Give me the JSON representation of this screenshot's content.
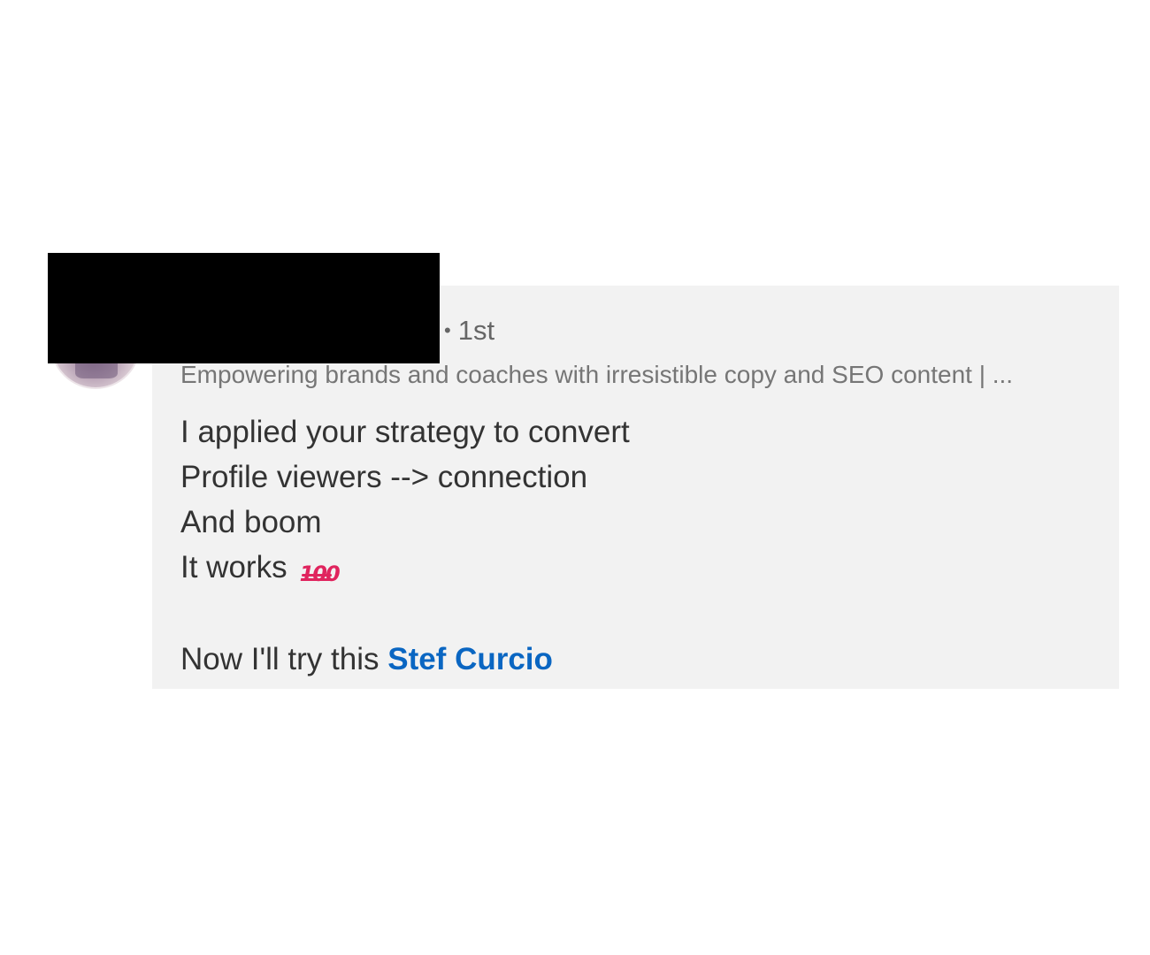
{
  "comment": {
    "author_degree": "1st",
    "author_headline": "Empowering brands and coaches with irresistible copy and SEO content | ...",
    "lines": [
      "I applied your strategy to convert",
      "Profile viewers --> connection",
      "And boom",
      "It works"
    ],
    "emoji": "hundred-points-icon",
    "closing_prefix": "Now I'll try this ",
    "mention": "Stef Curcio"
  },
  "colors": {
    "bubble_background": "#f2f2f2",
    "mention_link": "#0a66c2",
    "redaction": "#000000"
  }
}
